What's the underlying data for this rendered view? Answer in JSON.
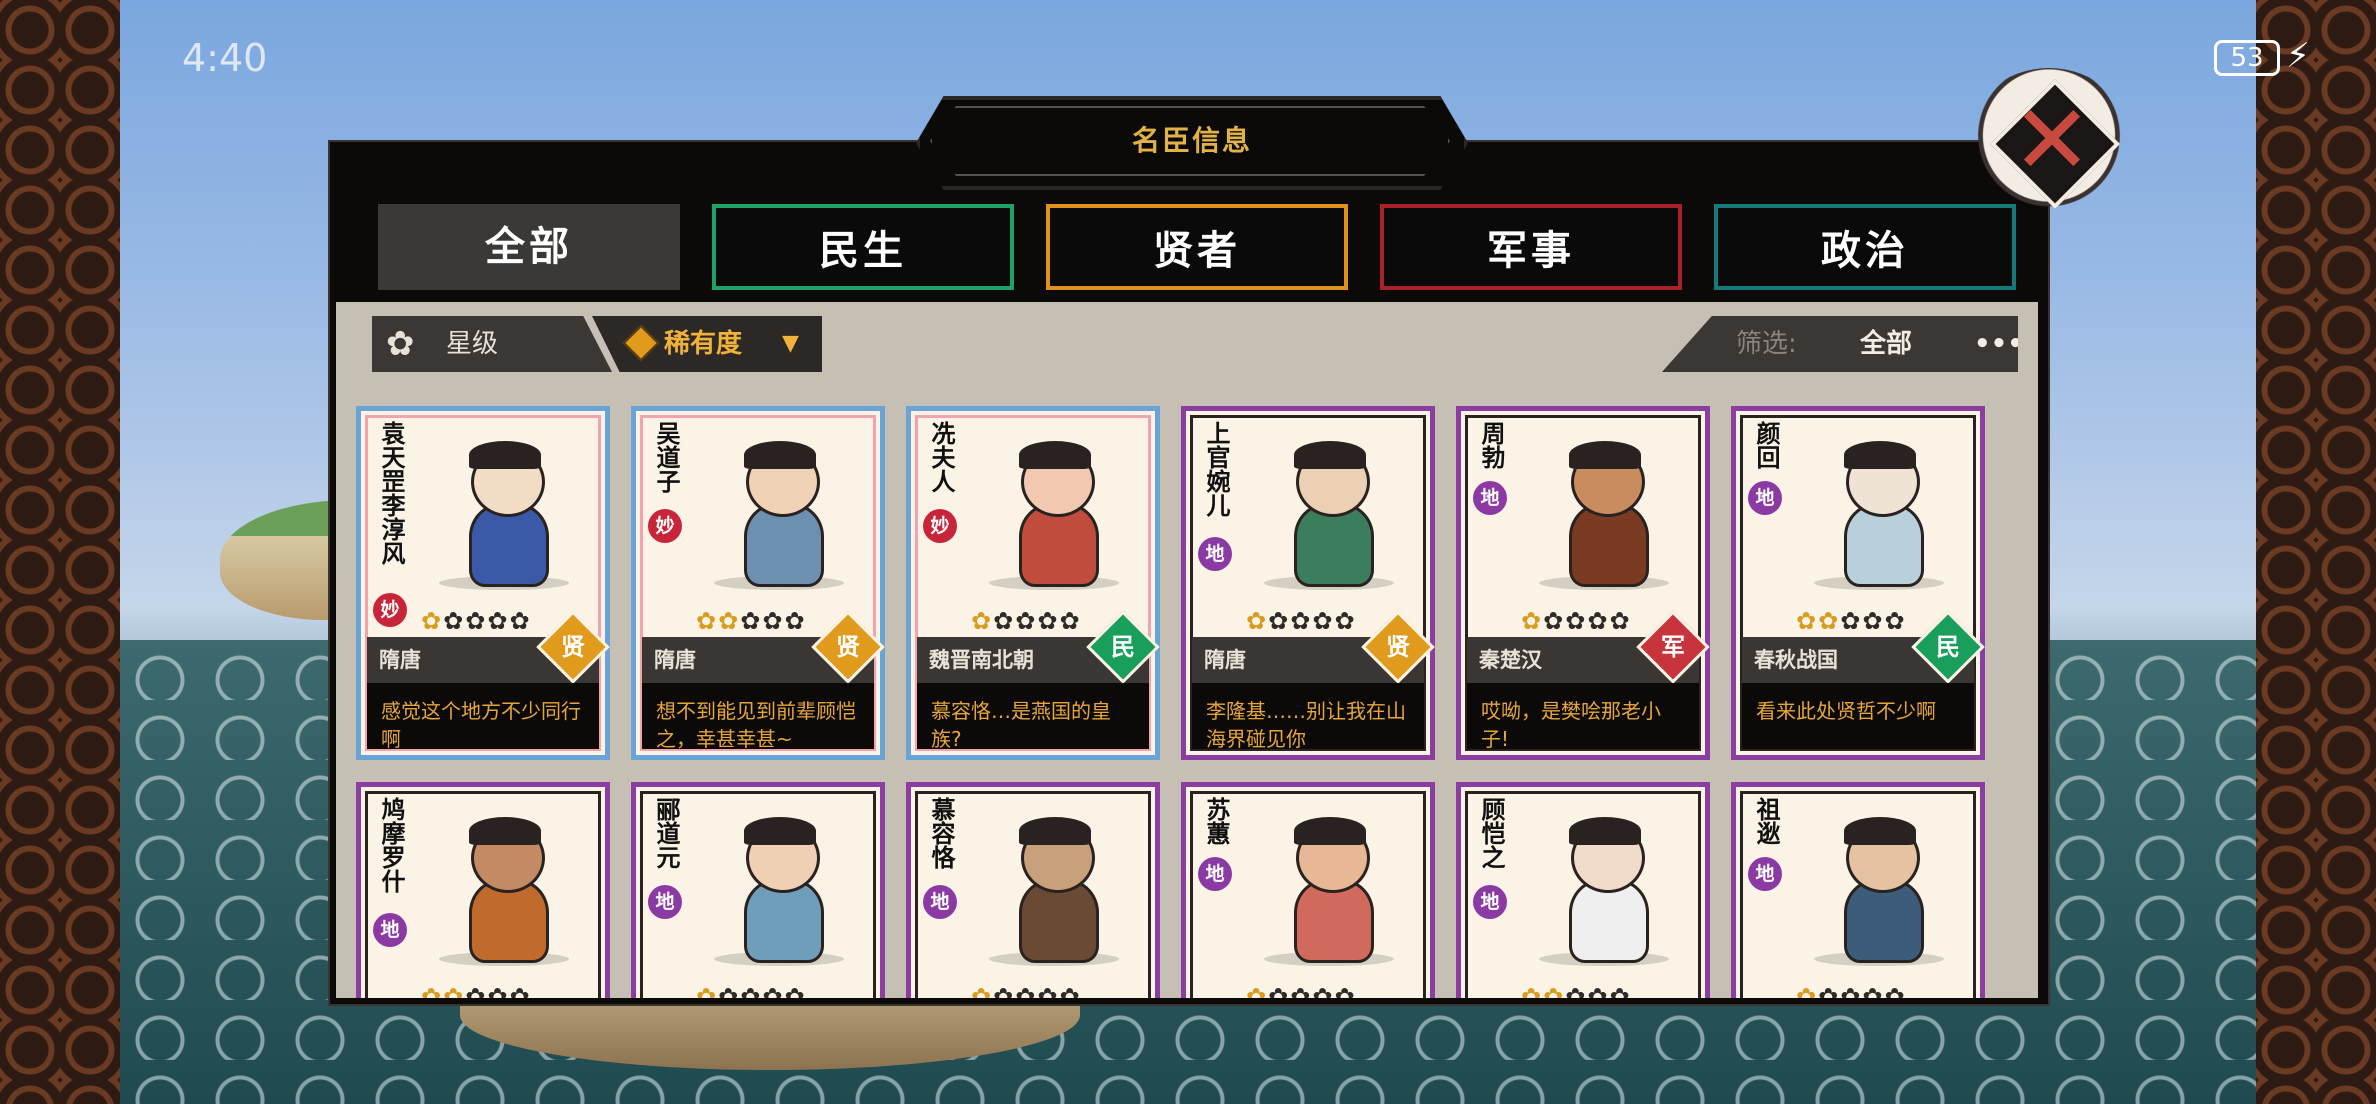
{
  "status_bar": {
    "time": "4:40",
    "battery": "53"
  },
  "panel": {
    "title": "名臣信息"
  },
  "tabs": [
    {
      "label": "全部",
      "active": true
    },
    {
      "label": "民生"
    },
    {
      "label": "贤者"
    },
    {
      "label": "军事"
    },
    {
      "label": "政治"
    }
  ],
  "sort": {
    "star_label": "星级",
    "rarity_label": "稀有度"
  },
  "filter": {
    "label": "筛选:",
    "value": "全部",
    "more": "•••"
  },
  "icons": {
    "rank_miao": "妙",
    "rank_di": "地",
    "role_xian": "贤",
    "role_min": "民",
    "role_jun": "军"
  },
  "cards": [
    {
      "name": "袁天罡李淳风",
      "rank": "妙",
      "stars": 1,
      "era": "隋唐",
      "role": "贤",
      "quote": "感觉这个地方不少同行啊"
    },
    {
      "name": "吴道子",
      "rank": "妙",
      "stars": 2,
      "era": "隋唐",
      "role": "贤",
      "quote": "想不到能见到前辈顾恺之，幸甚幸甚~"
    },
    {
      "name": "冼夫人",
      "rank": "妙",
      "stars": 1,
      "era": "魏晋南北朝",
      "role": "民",
      "quote": "慕容恪…是燕国的皇族?"
    },
    {
      "name": "上官婉儿",
      "rank": "地",
      "stars": 1,
      "era": "隋唐",
      "role": "贤",
      "quote": "李隆基……别让我在山海界碰见你"
    },
    {
      "name": "周勃",
      "rank": "地",
      "stars": 1,
      "era": "秦楚汉",
      "role": "军",
      "quote": "哎呦，是樊哙那老小子!"
    },
    {
      "name": "颜回",
      "rank": "地",
      "stars": 2,
      "era": "春秋战国",
      "role": "民",
      "quote": "看来此处贤哲不少啊"
    },
    {
      "name": "鸠摩罗什",
      "rank": "地",
      "stars": 2
    },
    {
      "name": "郦道元",
      "rank": "地",
      "stars": 1
    },
    {
      "name": "慕容恪",
      "rank": "地",
      "stars": 1
    },
    {
      "name": "苏蕙",
      "rank": "地",
      "stars": 1
    },
    {
      "name": "顾恺之",
      "rank": "地",
      "stars": 2
    },
    {
      "name": "祖逖",
      "rank": "地",
      "stars": 1
    }
  ],
  "colors": {
    "accent_gold": "#e2b24a",
    "tab_min": "#1fa26a",
    "tab_xian": "#e0901c",
    "tab_jun": "#a8222a",
    "tab_zheng": "#167a7a"
  }
}
